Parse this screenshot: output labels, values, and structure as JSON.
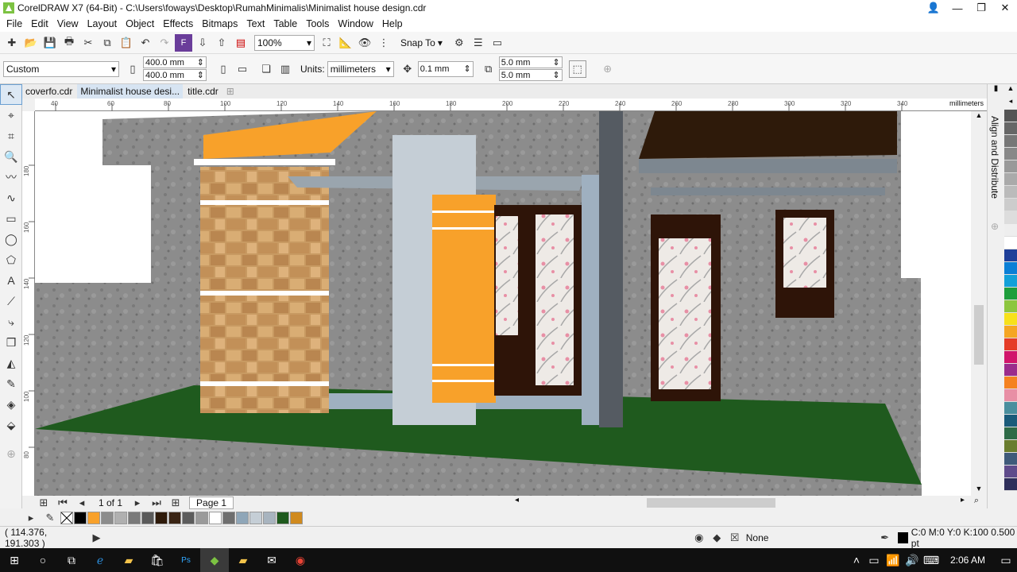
{
  "window": {
    "title": "CorelDRAW X7 (64-Bit) - C:\\Users\\foways\\Desktop\\RumahMinimalis\\Minimalist house design.cdr"
  },
  "menu": [
    "File",
    "Edit",
    "View",
    "Layout",
    "Object",
    "Effects",
    "Bitmaps",
    "Text",
    "Table",
    "Tools",
    "Window",
    "Help"
  ],
  "toolbar1": {
    "zoom": "100%",
    "snap_to": "Snap To"
  },
  "toolbar2": {
    "page_size": "Custom",
    "width": "400.0 mm",
    "height": "400.0 mm",
    "units_label": "Units:",
    "units": "millimeters",
    "nudge": "0.1 mm",
    "dup_x": "5.0 mm",
    "dup_y": "5.0 mm"
  },
  "tabs": [
    {
      "label": "coverfo.cdr"
    },
    {
      "label": "Minimalist house desi..."
    },
    {
      "label": "title.cdr"
    }
  ],
  "hruler": {
    "ticks": [
      "40",
      "60",
      "80",
      "100",
      "120",
      "140",
      "160",
      "180",
      "200",
      "220",
      "240",
      "260",
      "280",
      "300",
      "320",
      "340"
    ],
    "unit": "millimeters"
  },
  "vruler": {
    "ticks": [
      "180",
      "160",
      "140",
      "120",
      "100",
      "80"
    ],
    "unit": "millimeters"
  },
  "docker": {
    "title": "Align and Distribute"
  },
  "pager": {
    "page_count": "1 of 1",
    "page_tab": "Page 1"
  },
  "status": {
    "coords": "( 114.376, 191.303 )",
    "fill_label": "None",
    "outline_info": "C:0 M:0 Y:0 K:100  0.500 pt"
  },
  "taskbar": {
    "time": "2:06 AM"
  },
  "colors": {
    "orange": "#f8a12a",
    "grass": "#1f5a1e",
    "roof": "#2e1a0a",
    "concrete": "#8c8c8c",
    "pillar": "#c5ced6"
  },
  "palette_colors": [
    "#555555",
    "#666666",
    "#777777",
    "#888888",
    "#999999",
    "#aaaaaa",
    "#bbbbbb",
    "#cccccc",
    "#dddddd",
    "#eeeeee",
    "#ffffff",
    "#1e3f99",
    "#0a7fd6",
    "#12a0d8",
    "#1e9e3c",
    "#8dc63f",
    "#f7e11b",
    "#f5a623",
    "#e53c27",
    "#d1156b",
    "#9b2c8c",
    "#f58220",
    "#e88fa5",
    "#4a8f9e",
    "#1a5b7a",
    "#2e6b47",
    "#6a7d2e",
    "#3f5a7a",
    "#5f4b8b",
    "#2e2e5a"
  ],
  "swatches": [
    "#000000",
    "#f8a12a",
    "#8c8c8c",
    "#b0b0b0",
    "#7a7a7a",
    "#5a5a5a",
    "#2e1a0a",
    "#3a2414",
    "#5c5c5c",
    "#9a9a9a",
    "#ffffff",
    "#6e6e6e",
    "#8fa6b8",
    "#c5ced6",
    "#a8b4bf",
    "#1f5a1e",
    "#d08a1e"
  ]
}
